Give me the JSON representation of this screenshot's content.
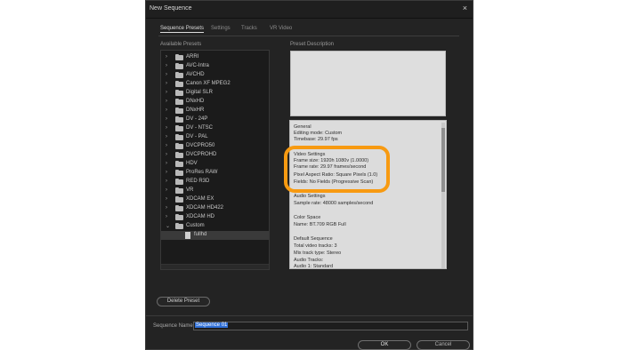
{
  "dialog": {
    "title": "New Sequence",
    "close_glyph": "×"
  },
  "tabs": [
    {
      "label": "Sequence Presets",
      "active": true
    },
    {
      "label": "Settings",
      "active": false
    },
    {
      "label": "Tracks",
      "active": false
    },
    {
      "label": "VR Video",
      "active": false
    }
  ],
  "presets": {
    "header": "Available Presets",
    "items": [
      {
        "label": "ARRI",
        "expanded": false
      },
      {
        "label": "AVC-Intra",
        "expanded": false
      },
      {
        "label": "AVCHD",
        "expanded": false
      },
      {
        "label": "Canon XF MPEG2",
        "expanded": false
      },
      {
        "label": "Digital SLR",
        "expanded": false
      },
      {
        "label": "DNxHD",
        "expanded": false
      },
      {
        "label": "DNxHR",
        "expanded": false
      },
      {
        "label": "DV - 24P",
        "expanded": false
      },
      {
        "label": "DV - NTSC",
        "expanded": false
      },
      {
        "label": "DV - PAL",
        "expanded": false
      },
      {
        "label": "DVCPRO50",
        "expanded": false
      },
      {
        "label": "DVCPROHD",
        "expanded": false
      },
      {
        "label": "HDV",
        "expanded": false
      },
      {
        "label": "ProRes RAW",
        "expanded": false
      },
      {
        "label": "RED R3D",
        "expanded": false
      },
      {
        "label": "VR",
        "expanded": false
      },
      {
        "label": "XDCAM EX",
        "expanded": false
      },
      {
        "label": "XDCAM HD422",
        "expanded": false
      },
      {
        "label": "XDCAM HD",
        "expanded": false
      },
      {
        "label": "Custom",
        "expanded": true
      }
    ],
    "child": {
      "label": "fullhd",
      "selected": true
    },
    "chevron_collapsed": "›",
    "chevron_expanded": "⌄"
  },
  "description": {
    "header": "Preset Description",
    "lines": [
      "General",
      "Editing mode: Custom",
      "Timebase: 29.97 fps",
      "",
      "Video Settings",
      "Frame size: 1920h 1080v (1.0000)",
      "Frame rate: 29.97  frames/second",
      "Pixel Aspect Ratio: Square Pixels (1.0)",
      "Fields: No Fields (Progressive Scan)",
      "",
      "Audio Settings",
      "Sample rate: 48000 samples/second",
      "",
      "Color Space",
      "Name: BT.709 RGB Full",
      "",
      "Default Sequence",
      "Total video tracks: 3",
      "Mix track type: Stereo",
      "Audio Tracks:",
      "Audio 1: Standard"
    ]
  },
  "buttons": {
    "delete_preset": "Delete Preset",
    "ok": "OK",
    "cancel": "Cancel"
  },
  "sequence_name": {
    "label": "Sequence Name:",
    "value": "Sequence 01"
  },
  "colors": {
    "highlight": "#f79a11",
    "selection": "#2f6fd6",
    "dialog_bg": "#232323"
  }
}
